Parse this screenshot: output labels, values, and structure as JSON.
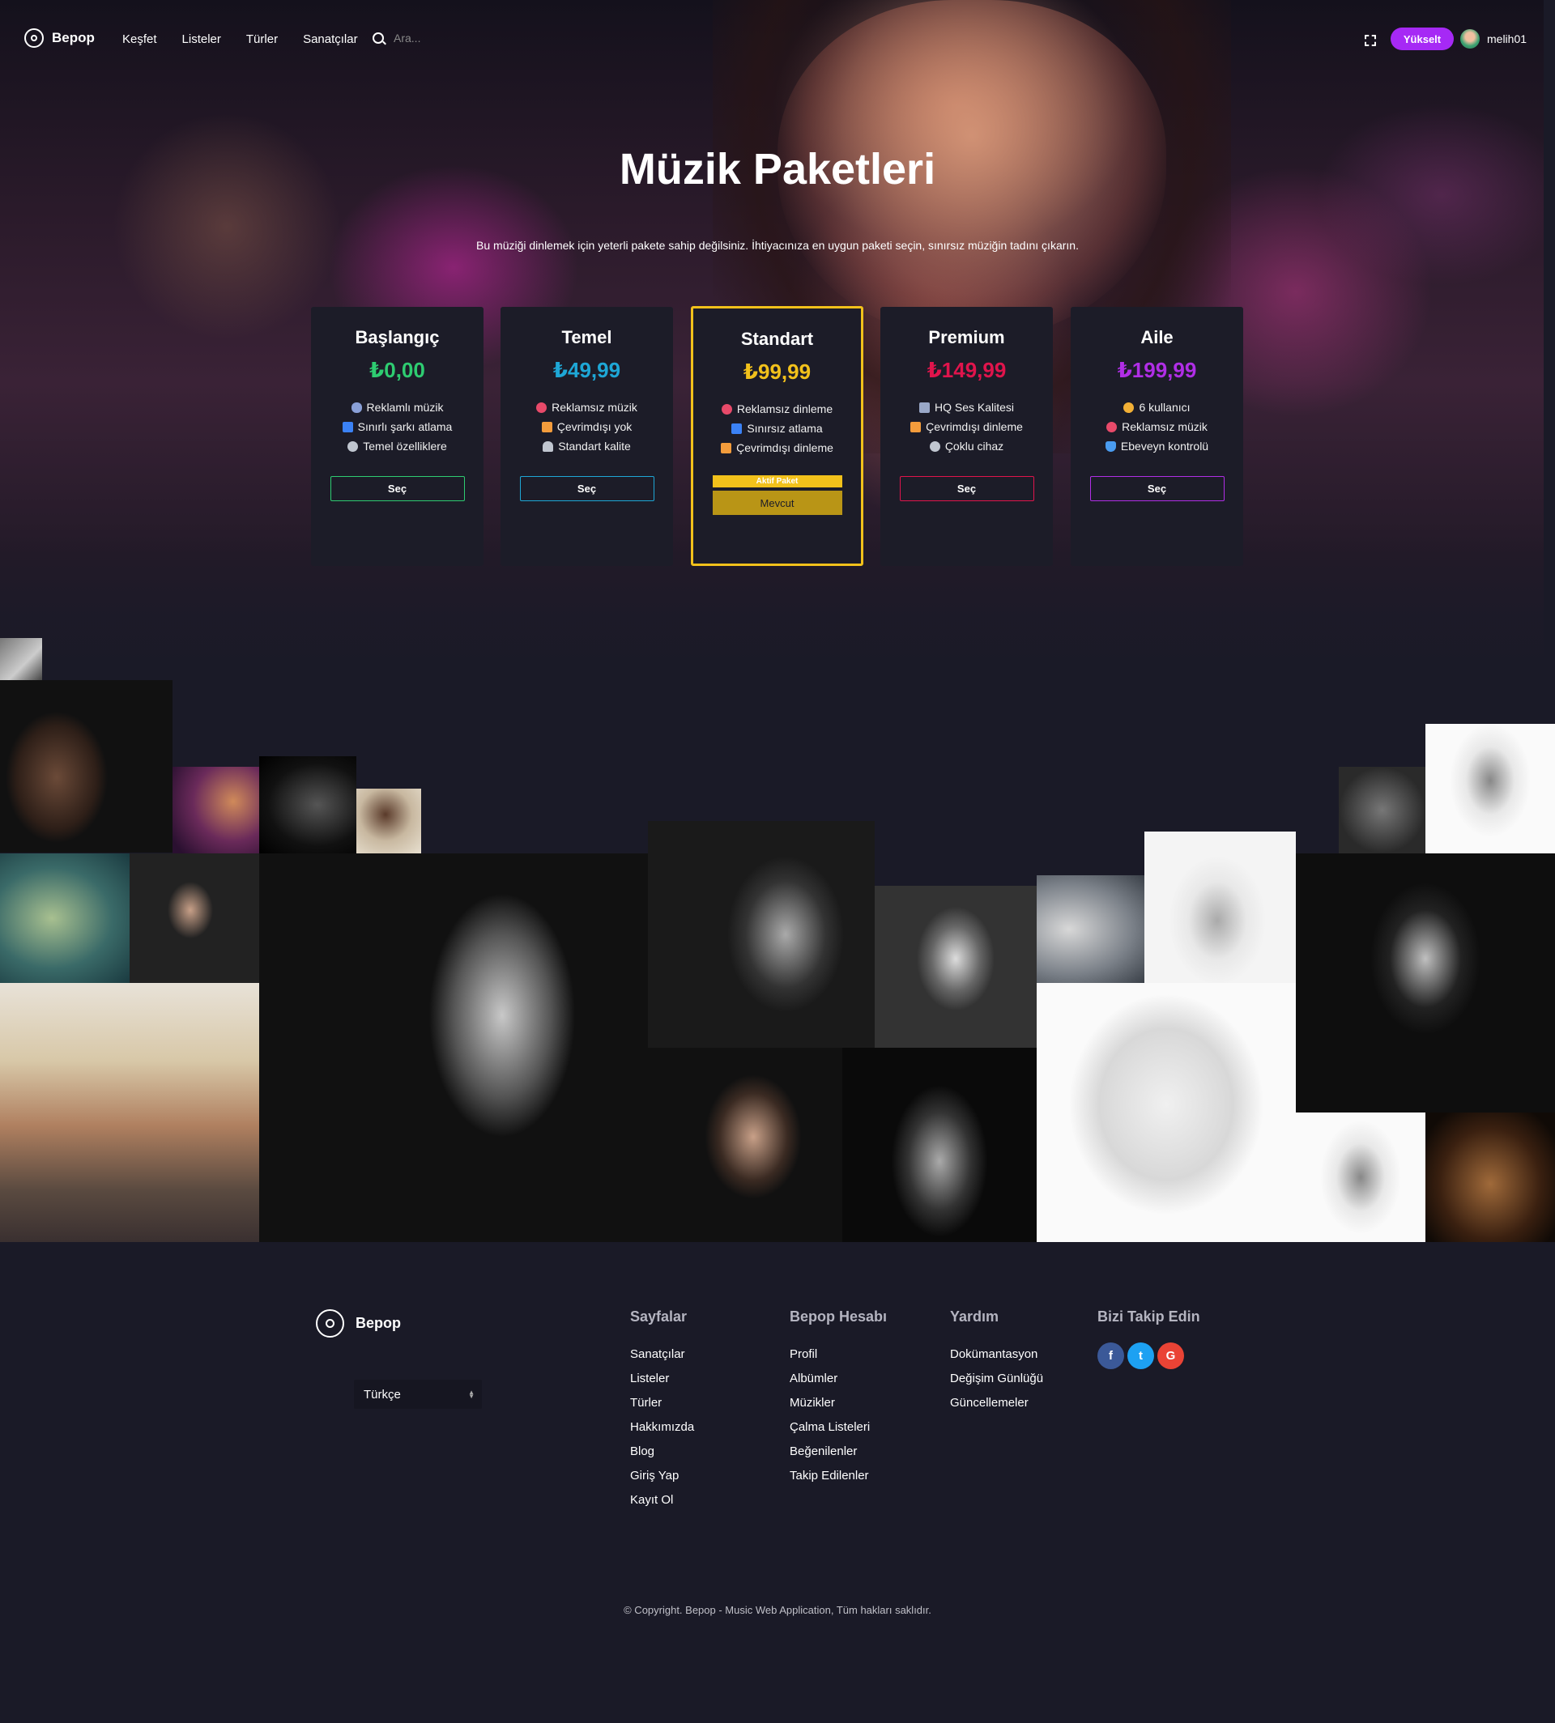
{
  "nav": {
    "brand": "Bepop",
    "links": [
      "Keşfet",
      "Listeler",
      "Türler",
      "Sanatçılar"
    ],
    "search_placeholder": "Ara...",
    "upgrade_label": "Yükselt",
    "username": "melih01"
  },
  "hero": {
    "title": "Müzik Paketleri",
    "subtitle": "Bu müziği dinlemek için yeterli pakete sahip değilsiniz. İhtiyacınıza en uygun paketi seçin, sınırsız müziğin tadını çıkarın."
  },
  "plans": [
    {
      "name": "Başlangıç",
      "price": "₺0,00",
      "color": "#2ecc71",
      "features": [
        {
          "icon": "music-note-icon",
          "text": "Reklamlı müzik"
        },
        {
          "icon": "skip-icon",
          "text": "Sınırlı şarkı atlama"
        },
        {
          "icon": "gear-icon",
          "text": "Temel özelliklere"
        }
      ],
      "button": "Seç"
    },
    {
      "name": "Temel",
      "price": "₺49,99",
      "color": "#1ea7d6",
      "features": [
        {
          "icon": "no-entry-icon",
          "text": "Reklamsız müzik"
        },
        {
          "icon": "offline-icon",
          "text": "Çevrimdışı yok"
        },
        {
          "icon": "headphones-icon",
          "text": "Standart kalite"
        }
      ],
      "button": "Seç"
    },
    {
      "name": "Standart",
      "price": "₺99,99",
      "color": "#f2c11b",
      "features": [
        {
          "icon": "no-entry-icon",
          "text": "Reklamsız dinleme"
        },
        {
          "icon": "skip-icon",
          "text": "Sınırsız atlama"
        },
        {
          "icon": "offline-icon",
          "text": "Çevrimdışı dinleme"
        }
      ],
      "badge": "Aktif Paket",
      "button": "Mevcut"
    },
    {
      "name": "Premium",
      "price": "₺149,99",
      "color": "#e0144c",
      "features": [
        {
          "icon": "speaker-icon",
          "text": "HQ Ses Kalitesi"
        },
        {
          "icon": "offline-icon",
          "text": "Çevrimdışı dinleme"
        },
        {
          "icon": "link-icon",
          "text": "Çoklu cihaz"
        }
      ],
      "button": "Seç"
    },
    {
      "name": "Aile",
      "price": "₺199,99",
      "color": "#b02ee6",
      "features": [
        {
          "icon": "family-icon",
          "text": "6 kullanıcı"
        },
        {
          "icon": "no-entry-icon",
          "text": "Reklamsız müzik"
        },
        {
          "icon": "shield-icon",
          "text": "Ebeveyn kontrolü"
        }
      ],
      "button": "Seç"
    }
  ],
  "footer": {
    "brand": "Bepop",
    "language": "Türkçe",
    "columns": [
      {
        "title": "Sayfalar",
        "links": [
          "Sanatçılar",
          "Listeler",
          "Türler",
          "Hakkımızda",
          "Blog",
          "Giriş Yap",
          "Kayıt Ol"
        ]
      },
      {
        "title": "Bepop Hesabı",
        "links": [
          "Profil",
          "Albümler",
          "Müzikler",
          "Çalma Listeleri",
          "Beğenilenler",
          "Takip Edilenler"
        ]
      },
      {
        "title": "Yardım",
        "links": [
          "Dokümantasyon",
          "Değişim Günlüğü",
          "Güncellemeler"
        ]
      }
    ],
    "social_title": "Bizi Takip Edin",
    "social": [
      {
        "name": "facebook",
        "glyph": "f",
        "color": "#3b5998"
      },
      {
        "name": "twitter",
        "glyph": "t",
        "color": "#1da1f2"
      },
      {
        "name": "google",
        "glyph": "G",
        "color": "#ea4335"
      }
    ],
    "copyright": "© Copyright. Bepop - Music Web Application, Tüm hakları saklıdır."
  }
}
